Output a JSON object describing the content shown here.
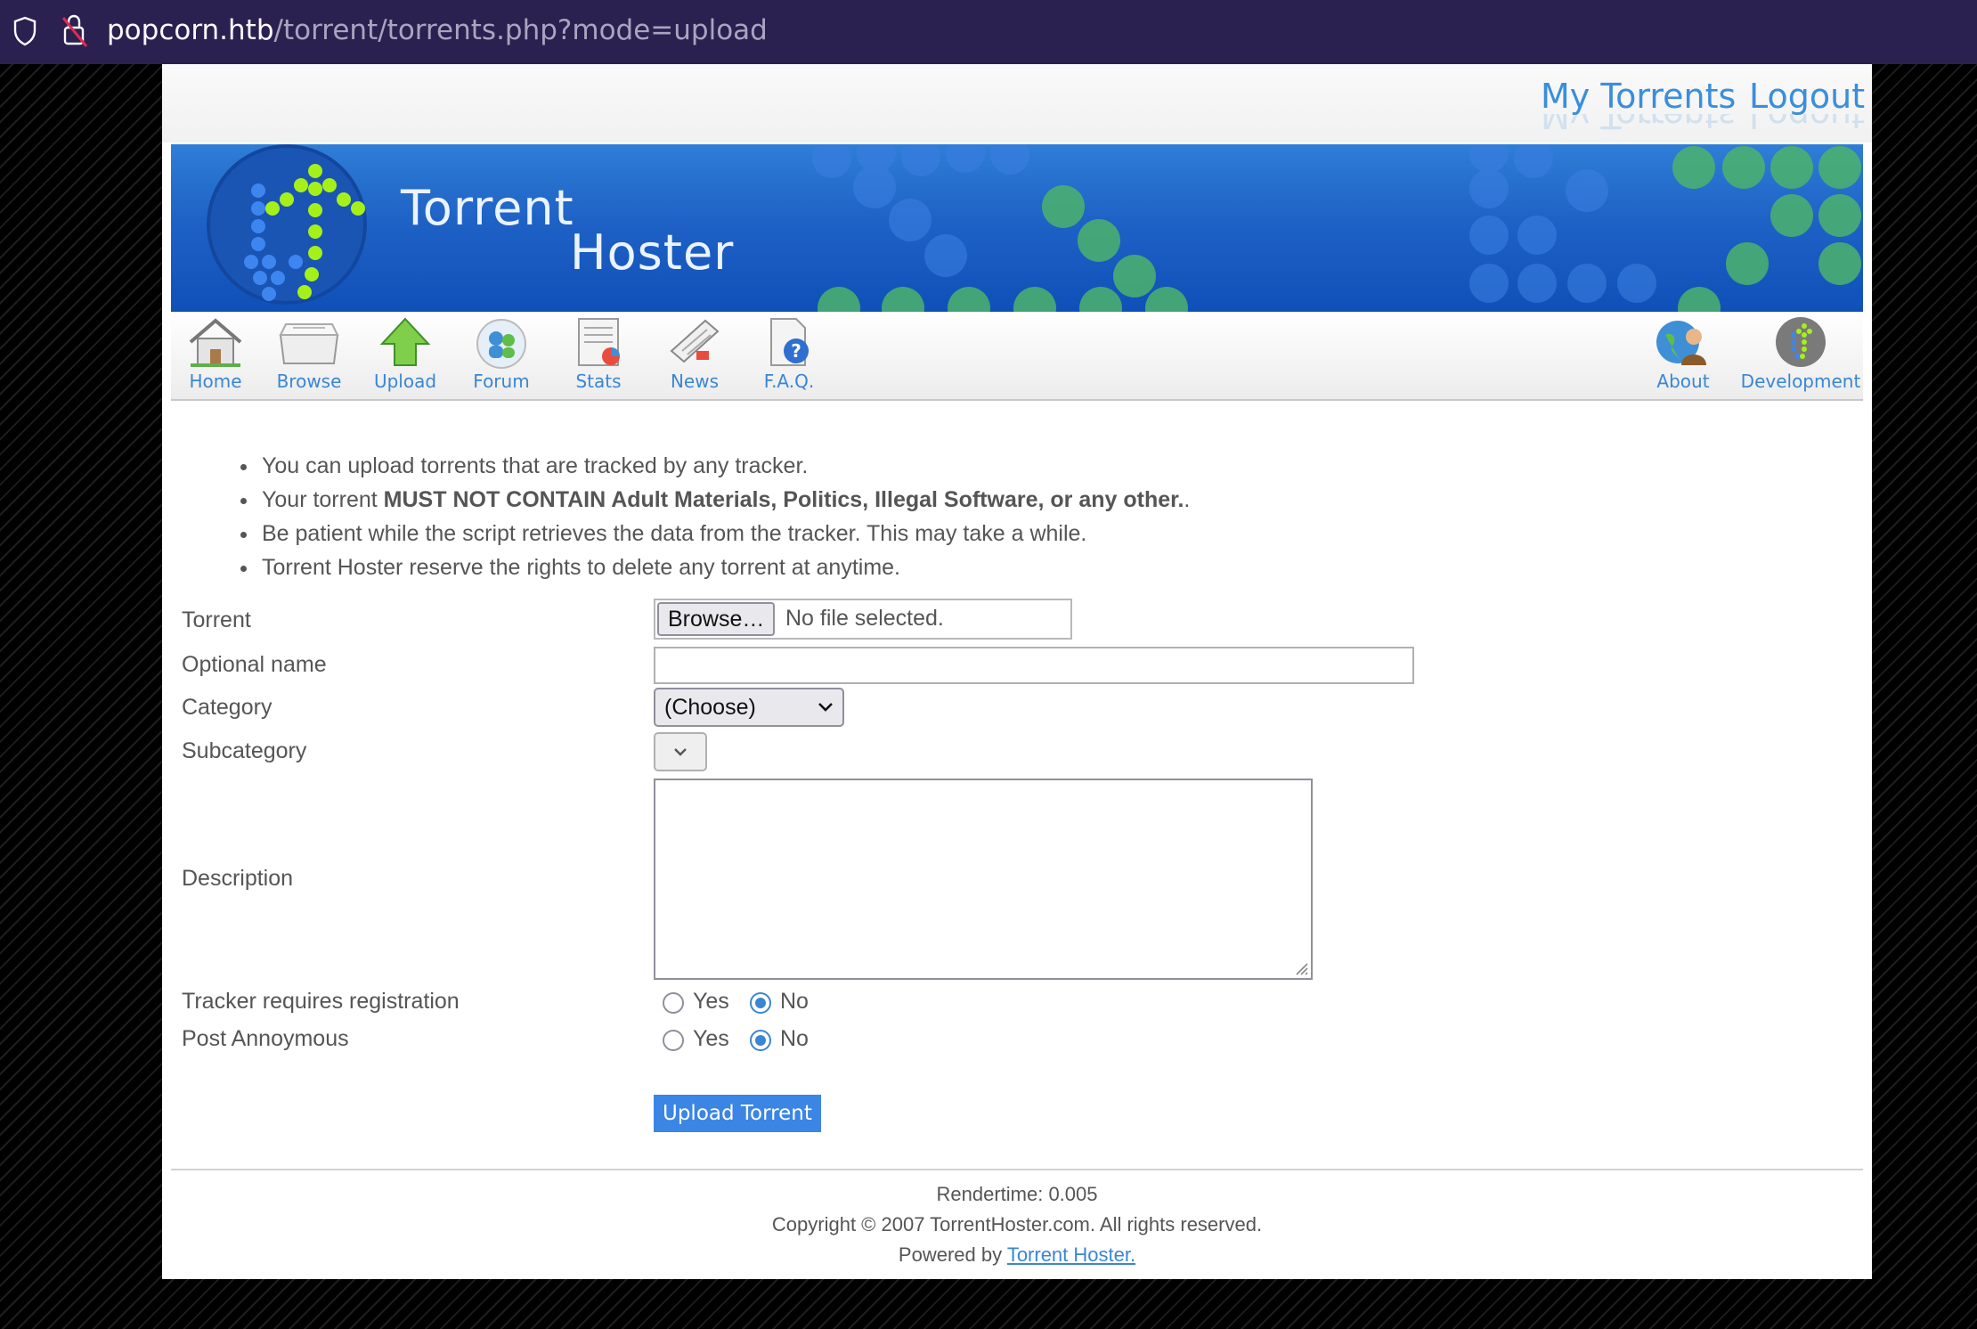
{
  "browser": {
    "url_host": "popcorn.htb",
    "url_path": "/torrent/torrents.php?mode=upload"
  },
  "top_links": {
    "my_torrents": "My Torrents",
    "logout": "Logout"
  },
  "banner": {
    "title_line1": "Torrent",
    "title_line2": "Hoster"
  },
  "nav": {
    "items": [
      {
        "label": "Home",
        "icon": "home-icon"
      },
      {
        "label": "Browse",
        "icon": "browse-icon"
      },
      {
        "label": "Upload",
        "icon": "upload-arrow-icon"
      },
      {
        "label": "Forum",
        "icon": "forum-icon"
      },
      {
        "label": "Stats",
        "icon": "stats-icon"
      },
      {
        "label": "News",
        "icon": "news-icon"
      },
      {
        "label": "F.A.Q.",
        "icon": "faq-icon"
      },
      {
        "label": "About",
        "icon": "about-icon"
      },
      {
        "label": "Development",
        "icon": "development-icon"
      }
    ]
  },
  "rules": {
    "r1": "You can upload torrents that are tracked by any tracker.",
    "r2_prefix": "Your torrent ",
    "r2_bold": "MUST NOT CONTAIN Adult Materials, Politics, Illegal Software, or any other.",
    "r2_suffix": ".",
    "r3": "Be patient while the script retrieves the data from the tracker. This may take a while.",
    "r4": "Torrent Hoster reserve the rights to delete any torrent at anytime."
  },
  "form": {
    "torrent_label": "Torrent",
    "browse_button": "Browse…",
    "file_status": "No file selected.",
    "optional_name_label": "Optional name",
    "optional_name_value": "",
    "category_label": "Category",
    "category_selected": "(Choose)",
    "subcategory_label": "Subcategory",
    "description_label": "Description",
    "tracker_reg_label": "Tracker requires registration",
    "tracker_reg_value": "No",
    "post_anon_label": "Post Annoymous",
    "post_anon_value": "No",
    "yes_label": "Yes",
    "no_label": "No",
    "submit_label": "Upload Torrent"
  },
  "footer": {
    "rendertime": "Rendertime: 0.005",
    "copyright": "Copyright © 2007 TorrentHoster.com. All rights reserved.",
    "powered_prefix": "Powered by ",
    "powered_link": "Torrent Hoster."
  },
  "colors": {
    "link_blue": "#3a8edb",
    "banner_blue": "#1f62c6",
    "button_blue": "#3b85e4",
    "url_bar": "#2a2150"
  }
}
